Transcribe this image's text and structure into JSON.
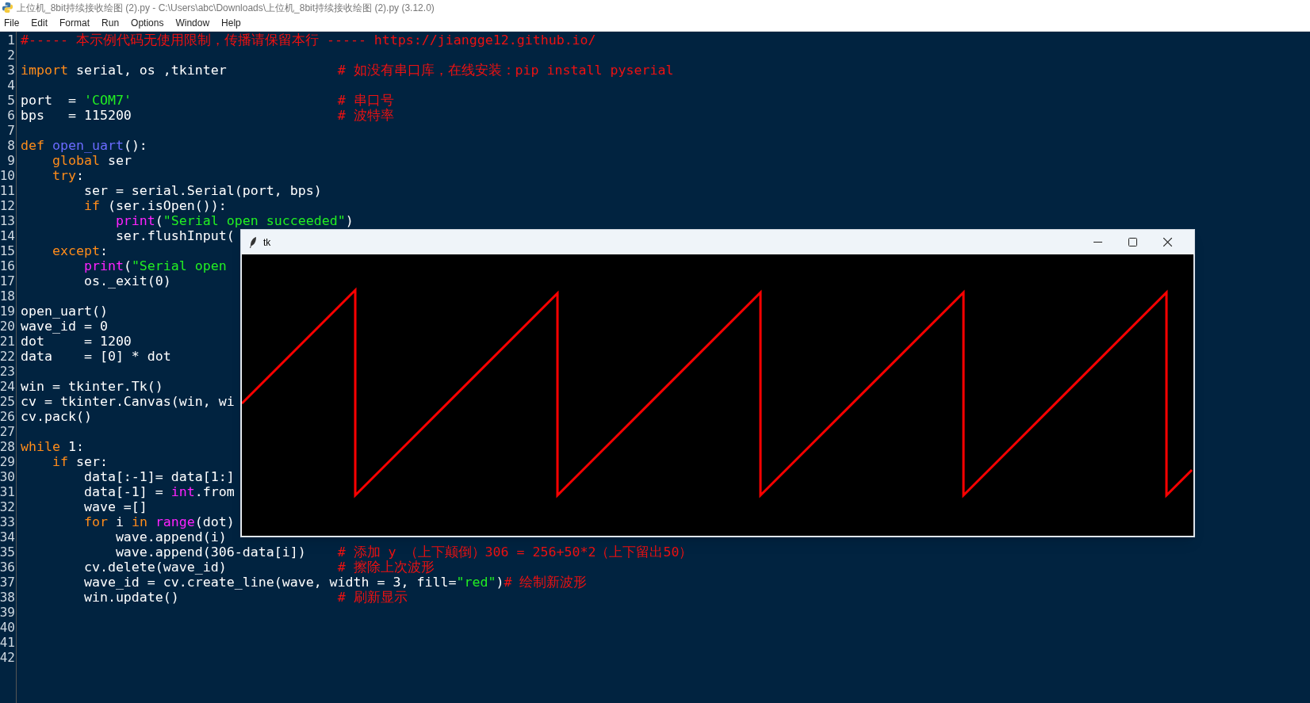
{
  "window": {
    "title": "上位机_8bit持续接收绘图 (2).py - C:\\Users\\abc\\Downloads\\上位机_8bit持续接收绘图 (2).py (3.12.0)"
  },
  "menu": [
    "File",
    "Edit",
    "Format",
    "Run",
    "Options",
    "Window",
    "Help"
  ],
  "editor": {
    "lines": [
      {
        "number": "1",
        "tokens": [
          {
            "kind": "comment",
            "text": "#----- 本示例代码无使用限制，传播请保留本行 ----- https://jiangge12.github.io/"
          }
        ]
      },
      {
        "number": "2"
      },
      {
        "number": "3",
        "tokens": [
          {
            "kind": "keyword",
            "text": "import"
          },
          {
            "kind": "plain",
            "text": " serial, os ,tkinter              "
          },
          {
            "kind": "comment",
            "text": "# 如没有串口库，在线安装：pip install pyserial"
          }
        ]
      },
      {
        "number": "4"
      },
      {
        "number": "5",
        "tokens": [
          {
            "kind": "plain",
            "text": "port  = "
          },
          {
            "kind": "string",
            "text": "'COM7'"
          },
          {
            "kind": "comment",
            "text": "                          # 串口号"
          }
        ]
      },
      {
        "number": "6",
        "tokens": [
          {
            "kind": "plain",
            "text": "bps   = 115200                          "
          },
          {
            "kind": "comment",
            "text": "# 波特率"
          }
        ]
      },
      {
        "number": "7"
      },
      {
        "number": "8",
        "tokens": [
          {
            "kind": "keyword",
            "text": "def "
          },
          {
            "kind": "definition",
            "text": "open_uart"
          },
          {
            "kind": "plain",
            "text": "():"
          }
        ]
      },
      {
        "number": "9",
        "tokens": [
          {
            "kind": "keyword",
            "text": "    global"
          },
          {
            "kind": "plain",
            "text": " ser"
          }
        ]
      },
      {
        "number": "10",
        "tokens": [
          {
            "kind": "keyword",
            "text": "    try"
          },
          {
            "kind": "plain",
            "text": ":"
          }
        ]
      },
      {
        "number": "11",
        "tokens": [
          {
            "kind": "plain",
            "text": "        ser = serial.Serial(port, bps)"
          }
        ]
      },
      {
        "number": "12",
        "tokens": [
          {
            "kind": "keyword",
            "text": "        if"
          },
          {
            "kind": "plain",
            "text": " (ser.isOpen()):"
          }
        ]
      },
      {
        "number": "13",
        "tokens": [
          {
            "kind": "builtin",
            "text": "            print"
          },
          {
            "kind": "plain",
            "text": "("
          },
          {
            "kind": "string",
            "text": "\"Serial open succeeded\""
          },
          {
            "kind": "plain",
            "text": ")"
          }
        ]
      },
      {
        "number": "14",
        "tokens": [
          {
            "kind": "plain",
            "text": "            ser.flushInput("
          }
        ]
      },
      {
        "number": "15",
        "tokens": [
          {
            "kind": "keyword",
            "text": "    except"
          },
          {
            "kind": "plain",
            "text": ":"
          }
        ]
      },
      {
        "number": "16",
        "tokens": [
          {
            "kind": "builtin",
            "text": "        print"
          },
          {
            "kind": "plain",
            "text": "("
          },
          {
            "kind": "string",
            "text": "\"Serial open"
          }
        ]
      },
      {
        "number": "17",
        "tokens": [
          {
            "kind": "plain",
            "text": "        os._exit(0)"
          }
        ]
      },
      {
        "number": "18"
      },
      {
        "number": "19",
        "tokens": [
          {
            "kind": "plain",
            "text": "open_uart()"
          }
        ]
      },
      {
        "number": "20",
        "tokens": [
          {
            "kind": "plain",
            "text": "wave_id = 0"
          }
        ]
      },
      {
        "number": "21",
        "tokens": [
          {
            "kind": "plain",
            "text": "dot     = 1200"
          }
        ]
      },
      {
        "number": "22",
        "tokens": [
          {
            "kind": "plain",
            "text": "data    = [0] * dot"
          }
        ]
      },
      {
        "number": "23"
      },
      {
        "number": "24",
        "tokens": [
          {
            "kind": "plain",
            "text": "win = tkinter.Tk()"
          }
        ]
      },
      {
        "number": "25",
        "tokens": [
          {
            "kind": "plain",
            "text": "cv = tkinter.Canvas(win, wi"
          }
        ]
      },
      {
        "number": "26",
        "tokens": [
          {
            "kind": "plain",
            "text": "cv.pack()"
          }
        ]
      },
      {
        "number": "27"
      },
      {
        "number": "28",
        "tokens": [
          {
            "kind": "keyword",
            "text": "while"
          },
          {
            "kind": "plain",
            "text": " 1:"
          }
        ]
      },
      {
        "number": "29",
        "tokens": [
          {
            "kind": "keyword",
            "text": "    if"
          },
          {
            "kind": "plain",
            "text": " ser:"
          }
        ]
      },
      {
        "number": "30",
        "tokens": [
          {
            "kind": "plain",
            "text": "        data[:-1]= data[1:]"
          }
        ]
      },
      {
        "number": "31",
        "tokens": [
          {
            "kind": "plain",
            "text": "        data[-1] = "
          },
          {
            "kind": "builtin",
            "text": "int"
          },
          {
            "kind": "plain",
            "text": ".from"
          }
        ]
      },
      {
        "number": "32",
        "tokens": [
          {
            "kind": "plain",
            "text": "        wave =[]"
          }
        ]
      },
      {
        "number": "33",
        "tokens": [
          {
            "kind": "keyword",
            "text": "        for"
          },
          {
            "kind": "plain",
            "text": " i "
          },
          {
            "kind": "keyword",
            "text": "in "
          },
          {
            "kind": "builtin",
            "text": "range"
          },
          {
            "kind": "plain",
            "text": "(dot)"
          }
        ]
      },
      {
        "number": "34",
        "tokens": [
          {
            "kind": "plain",
            "text": "            wave.append(i)"
          }
        ]
      },
      {
        "number": "35",
        "tokens": [
          {
            "kind": "plain",
            "text": "            wave.append(306-data[i])    "
          },
          {
            "kind": "comment",
            "text": "# 添加 y （上下颠倒）306 = 256+50*2（上下留出50）"
          }
        ]
      },
      {
        "number": "36",
        "tokens": [
          {
            "kind": "plain",
            "text": "        cv.delete(wave_id)              "
          },
          {
            "kind": "comment",
            "text": "# 擦除上次波形"
          }
        ]
      },
      {
        "number": "37",
        "tokens": [
          {
            "kind": "plain",
            "text": "        wave_id = cv.create_line(wave, width = 3, fill="
          },
          {
            "kind": "string",
            "text": "\"red\""
          },
          {
            "kind": "plain",
            "text": ")"
          },
          {
            "kind": "comment",
            "text": "# 绘制新波形"
          }
        ]
      },
      {
        "number": "38",
        "tokens": [
          {
            "kind": "plain",
            "text": "        win.update()                    "
          },
          {
            "kind": "comment",
            "text": "# 刷新显示"
          }
        ]
      },
      {
        "number": "39"
      },
      {
        "number": "40"
      },
      {
        "number": "41"
      },
      {
        "number": "42"
      }
    ]
  },
  "tk_window": {
    "title": "tk"
  }
}
